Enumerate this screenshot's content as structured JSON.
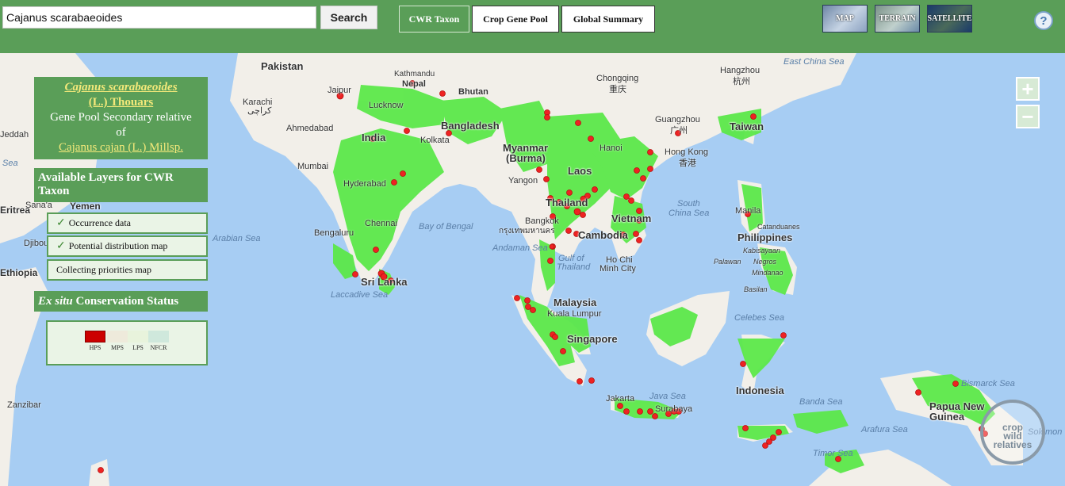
{
  "search": {
    "value": "Cajanus scarabaeoides",
    "button": "Search"
  },
  "tabs": [
    {
      "label": "CWR Taxon",
      "active": true
    },
    {
      "label": "Crop Gene Pool",
      "active": false
    },
    {
      "label": "Global Summary",
      "active": false
    }
  ],
  "map_types": [
    "MAP",
    "TERRAIN",
    "SATELLITE"
  ],
  "help_label": "?",
  "zoom": {
    "in": "+",
    "out": "−"
  },
  "taxon": {
    "name": "Cajanus scarabaeoides",
    "authority": "(L.) Thouars",
    "relation": "Gene Pool Secondary relative",
    "of": "of",
    "crop": "Cajanus cajan (L.) Millsp."
  },
  "layers": {
    "title": "Available Layers for CWR Taxon",
    "items": [
      {
        "label": "Occurrence data",
        "checked": true
      },
      {
        "label": "Potential distribution map",
        "checked": true
      },
      {
        "label": "Collecting priorities map",
        "checked": false
      }
    ]
  },
  "exsitu": {
    "title_italic": "Ex situ",
    "title_rest": "Conservation Status",
    "legend": [
      {
        "code": "HPS",
        "color": "#cc0000"
      },
      {
        "code": "MPS",
        "color": "#eeeadb"
      },
      {
        "code": "LPS",
        "color": "#e8f3dc"
      },
      {
        "code": "NFCR",
        "color": "#cfe8dc"
      }
    ]
  },
  "map_labels": {
    "countries": [
      "Pakistan",
      "Nepal",
      "Bhutan",
      "India",
      "Bangladesh",
      "Myanmar",
      "(Burma)",
      "Laos",
      "Thailand",
      "Vietnam",
      "Cambodia",
      "Taiwan",
      "Sri Lanka",
      "Malaysia",
      "Singapore",
      "Philippines",
      "Indonesia",
      "Papua New",
      "Guinea",
      "Yemen",
      "Djibouti",
      "Ethiopia",
      "Eritrea"
    ],
    "seas": [
      "East China Sea",
      "South",
      "China Sea",
      "Arabian Sea",
      "Bay of Bengal",
      "Andaman Sea",
      "Gulf of",
      "Thailand",
      "Laccadive Sea",
      "Celebes Sea",
      "Java Sea",
      "Banda Sea",
      "Arafura Sea",
      "Timor Sea",
      "Bismarck Sea",
      "Solomon",
      "Sea"
    ],
    "cities": [
      "Jaipur",
      "Lucknow",
      "Kathmandu",
      "Ahmedabad",
      "Kolkata",
      "Mumbai",
      "Hyderabad",
      "Chennai",
      "Bengaluru",
      "Chongqing",
      "重庆",
      "Hangzhou",
      "杭州",
      "Guangzhou",
      "广州",
      "Hong Kong",
      "香港",
      "Hanoi",
      "Yangon",
      "Bangkok",
      "กรุงเทพมหานคร",
      "Ho Chi",
      "Minh City",
      "Kuala Lumpur",
      "Jakarta",
      "Surabaya",
      "Manila",
      "Catanduanes",
      "Palawan",
      "Negros",
      "Mindanao",
      "Basilan",
      "Kabisayaan",
      "Zanzibar",
      "Sana'a",
      "Jeddah",
      "Sea",
      "Karachi",
      "كراچی"
    ]
  },
  "logo": {
    "line1": "crop",
    "line2": "wild",
    "line3": "relatives"
  },
  "map_colors": {
    "water": "#a7cdf3",
    "land": "#f2efe9",
    "distribution": "#5ce84a",
    "point": "#ee2222",
    "panel": "#5a9e58"
  }
}
